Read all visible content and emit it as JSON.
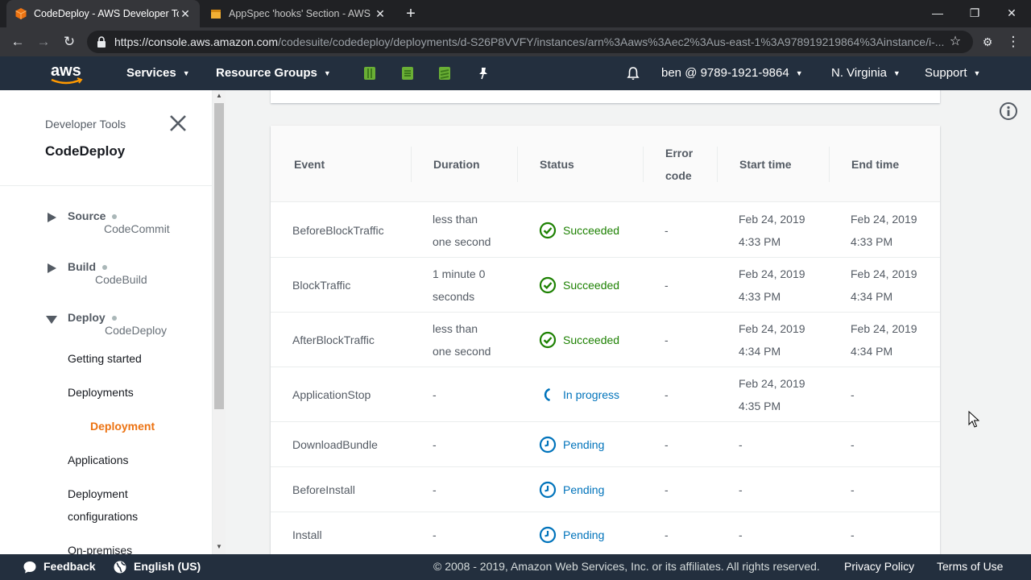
{
  "browser": {
    "tabs": [
      {
        "title": "CodeDeploy - AWS Developer Tools",
        "active": true
      },
      {
        "title": "AppSpec 'hooks' Section - AWS CodeDeploy",
        "active": false
      }
    ],
    "url_host": "https://console.aws.amazon.com",
    "url_path": "/codesuite/codedeploy/deployments/d-S26P8VVFY/instances/arn%3Aaws%3Aec2%3Aus-east-1%3A978919219864%3Ainstance/i-..."
  },
  "awsnav": {
    "services": "Services",
    "resource_groups": "Resource Groups",
    "account": "ben @ 9789-1921-9864",
    "region": "N. Virginia",
    "support": "Support"
  },
  "sidebar": {
    "crumb": "Developer Tools",
    "title": "CodeDeploy",
    "groups": [
      {
        "name": "Source",
        "sub": "CodeCommit"
      },
      {
        "name": "Build",
        "sub": "CodeBuild"
      },
      {
        "name": "Deploy",
        "sub": "CodeDeploy"
      }
    ],
    "links": {
      "getting_started": "Getting started",
      "deployments": "Deployments",
      "deployment": "Deployment",
      "applications": "Applications",
      "deployment_configurations_1": "Deployment",
      "deployment_configurations_2": "configurations",
      "on_premises": "On-premises"
    }
  },
  "table": {
    "headers": {
      "event": "Event",
      "duration": "Duration",
      "status": "Status",
      "error_code_1": "Error",
      "error_code_2": "code",
      "start_time": "Start time",
      "end_time": "End time"
    },
    "rows": [
      {
        "event": "BeforeBlockTraffic",
        "duration": [
          "less than",
          "one second"
        ],
        "status": "Succeeded",
        "error": "-",
        "start": [
          "Feb 24, 2019",
          "4:33 PM"
        ],
        "end": [
          "Feb 24, 2019",
          "4:33 PM"
        ]
      },
      {
        "event": "BlockTraffic",
        "duration": [
          "1 minute 0",
          "seconds"
        ],
        "status": "Succeeded",
        "error": "-",
        "start": [
          "Feb 24, 2019",
          "4:33 PM"
        ],
        "end": [
          "Feb 24, 2019",
          "4:34 PM"
        ]
      },
      {
        "event": "AfterBlockTraffic",
        "duration": [
          "less than",
          "one second"
        ],
        "status": "Succeeded",
        "error": "-",
        "start": [
          "Feb 24, 2019",
          "4:34 PM"
        ],
        "end": [
          "Feb 24, 2019",
          "4:34 PM"
        ]
      },
      {
        "event": "ApplicationStop",
        "duration": [
          "-"
        ],
        "status": "In progress",
        "error": "-",
        "start": [
          "Feb 24, 2019",
          "4:35 PM"
        ],
        "end": [
          "-"
        ]
      },
      {
        "event": "DownloadBundle",
        "duration": [
          "-"
        ],
        "status": "Pending",
        "error": "-",
        "start": [
          "-"
        ],
        "end": [
          "-"
        ]
      },
      {
        "event": "BeforeInstall",
        "duration": [
          "-"
        ],
        "status": "Pending",
        "error": "-",
        "start": [
          "-"
        ],
        "end": [
          "-"
        ]
      },
      {
        "event": "Install",
        "duration": [
          "-"
        ],
        "status": "Pending",
        "error": "-",
        "start": [
          "-"
        ],
        "end": [
          "-"
        ]
      }
    ]
  },
  "footer": {
    "feedback": "Feedback",
    "language": "English (US)",
    "copyright": "© 2008 - 2019, Amazon Web Services, Inc. or its affiliates. All rights reserved.",
    "privacy": "Privacy Policy",
    "terms": "Terms of Use"
  },
  "colors": {
    "aws_nav": "#232f3e",
    "accent_orange": "#ec7211",
    "success_green": "#1d8102",
    "info_blue": "#0073bb"
  }
}
